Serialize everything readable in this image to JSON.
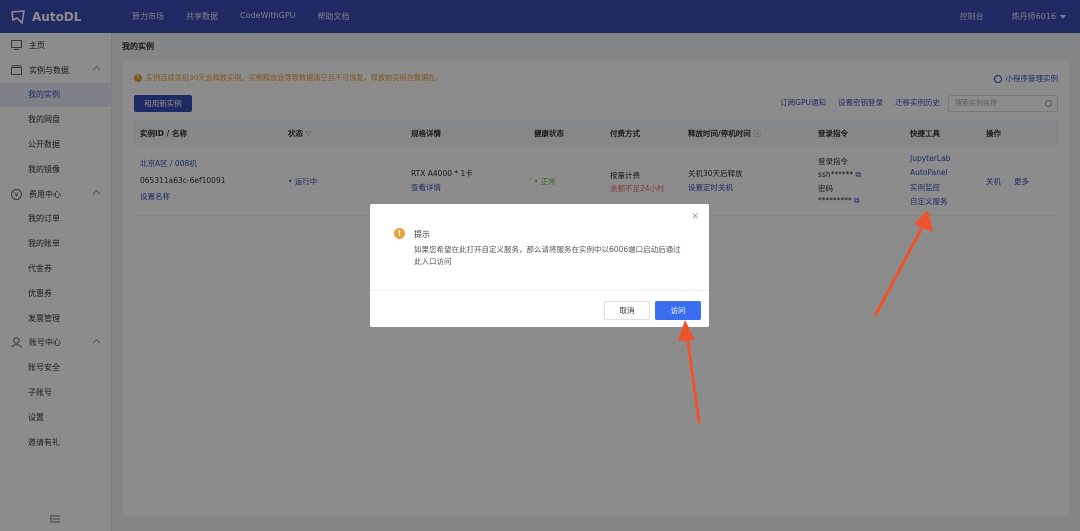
{
  "app": {
    "logo_text": "AutoDL"
  },
  "topnav": {
    "items": [
      "算力市场",
      "共享数据",
      "CodeWithGPU",
      "帮助文档"
    ],
    "console": "控制台",
    "user": "炼丹师6016"
  },
  "sidebar": {
    "items": [
      {
        "label": "主页",
        "type": "group",
        "icon": "home-icon"
      },
      {
        "label": "实例与数据",
        "type": "group",
        "icon": "folder-icon"
      },
      {
        "label": "我的实例",
        "type": "sub",
        "active": true
      },
      {
        "label": "我的网盘",
        "type": "sub"
      },
      {
        "label": "公开数据",
        "type": "sub"
      },
      {
        "label": "我的镜像",
        "type": "sub"
      },
      {
        "label": "费用中心",
        "type": "group",
        "icon": "yen-icon"
      },
      {
        "label": "我的订单",
        "type": "sub"
      },
      {
        "label": "我的账单",
        "type": "sub"
      },
      {
        "label": "代金券",
        "type": "sub"
      },
      {
        "label": "优惠券",
        "type": "sub"
      },
      {
        "label": "发票管理",
        "type": "sub"
      },
      {
        "label": "账号中心",
        "type": "group",
        "icon": "user-icon"
      },
      {
        "label": "账号安全",
        "type": "sub"
      },
      {
        "label": "子账号",
        "type": "sub"
      },
      {
        "label": "设置",
        "type": "sub"
      },
      {
        "label": "邀请有礼",
        "type": "sub"
      }
    ]
  },
  "main": {
    "title": "我的实例",
    "notice": "实例连续关机30天会释放实例。实例释放会导致数据清空且不可恢复，释放前实例在数据在。",
    "mini_program": "小程序管理实例",
    "new_button": "租用新实例",
    "actions": [
      "订阅GPU通知",
      "设置密钥登录",
      "迁移实例历史"
    ],
    "search_placeholder": "搜索实例名称",
    "columns": [
      "实例ID / 名称",
      "状态",
      "规格详情",
      "健康状态",
      "付费方式",
      "释放时间/停机时间",
      "登录指令",
      "快捷工具",
      "操作"
    ],
    "row": {
      "region": "北京A区 / 008机",
      "instance_id": "065311a63c-6ef10091",
      "set_name": "设置名称",
      "status": "运行中",
      "gpu": "RTX A4000 * 1卡",
      "spec_link": "查看详情",
      "health": "正常",
      "billing": "按量计费",
      "balance_warn": "余额不足24小时",
      "release": "关机30天后释放",
      "timer_link": "设置定时关机",
      "login_label": "登录指令",
      "ssh": "ssh******",
      "pwd_label": "密码",
      "pwd": "*********",
      "tools": [
        "JupyterLab",
        "AutoPanel",
        "实例监控",
        "自定义服务"
      ],
      "ops": [
        "关机",
        "更多"
      ]
    }
  },
  "dialog": {
    "title": "提示",
    "message": "如果您希望在此打开自定义服务，那么请将服务在实例中以6006端口启动后通过此入口访问",
    "cancel": "取消",
    "confirm": "访问"
  },
  "colors": {
    "brand": "#3a4db7",
    "warning": "#e6a23c",
    "confirm": "#3a6df0",
    "arrow": "#f0522a"
  }
}
